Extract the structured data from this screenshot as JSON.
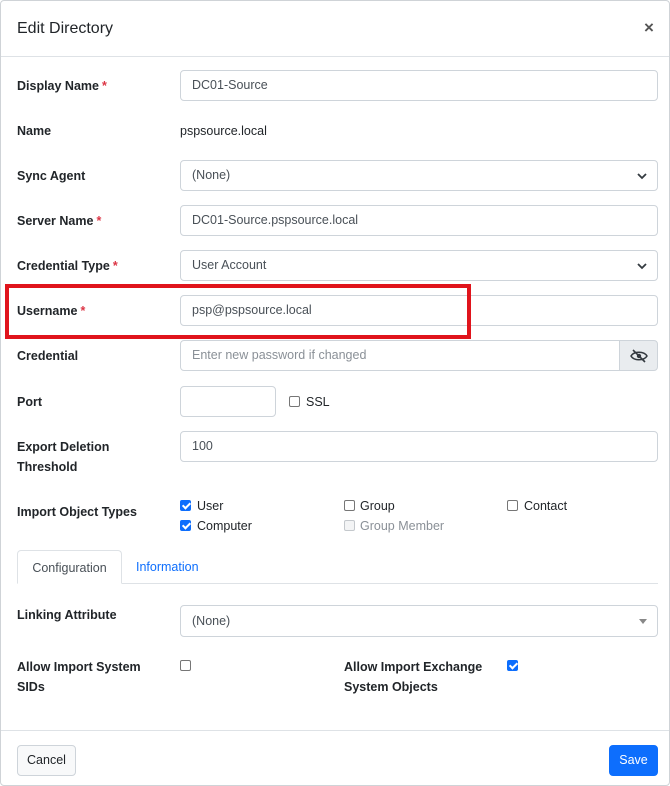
{
  "dialog": {
    "title": "Edit Directory",
    "close_glyph": "×"
  },
  "fields": {
    "display_name": {
      "label": "Display Name",
      "value": "DC01-Source"
    },
    "name": {
      "label": "Name",
      "value": "pspsource.local"
    },
    "sync_agent": {
      "label": "Sync Agent",
      "value": "(None)"
    },
    "server_name": {
      "label": "Server Name",
      "value": "DC01-Source.pspsource.local"
    },
    "credential_type": {
      "label": "Credential Type",
      "value": "User Account"
    },
    "username": {
      "label": "Username",
      "value": "psp@pspsource.local"
    },
    "credential": {
      "label": "Credential",
      "placeholder": "Enter new password if changed"
    },
    "port": {
      "label": "Port",
      "value": "",
      "ssl_label": "SSL",
      "ssl_checked": false
    },
    "export_deletion": {
      "label_line1": "Export Deletion",
      "label_line2": "Threshold",
      "value": "100"
    },
    "import_object_types": {
      "label": "Import Object Types",
      "options": [
        {
          "label": "User",
          "checked": true
        },
        {
          "label": "Group",
          "checked": false
        },
        {
          "label": "Contact",
          "checked": false
        },
        {
          "label": "Computer",
          "checked": true
        },
        {
          "label": "Group Member",
          "checked": false,
          "disabled": true
        }
      ]
    }
  },
  "required_marker": "*",
  "tabs": [
    {
      "label": "Configuration",
      "active": true
    },
    {
      "label": "Information",
      "active": false
    }
  ],
  "configuration": {
    "linking_attribute": {
      "label": "Linking Attribute",
      "value": "(None)"
    },
    "allow_import_system_sids": {
      "label_line1": "Allow Import System",
      "label_line2": "SIDs",
      "checked": false
    },
    "allow_import_exchange": {
      "label_line1": "Allow Import Exchange",
      "label_line2": "System Objects",
      "checked": true
    }
  },
  "footer": {
    "cancel_label": "Cancel",
    "save_label": "Save"
  },
  "colors": {
    "primary": "#0d6efd",
    "required": "#dc3545",
    "highlight": "#e0141c"
  }
}
